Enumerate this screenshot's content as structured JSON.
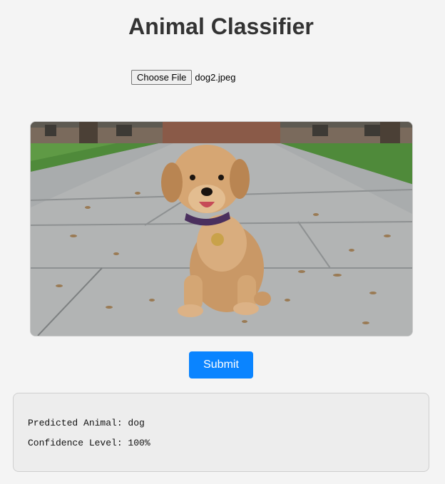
{
  "header": {
    "title": "Animal Classifier"
  },
  "file_input": {
    "button_label": "Choose File",
    "file_name": "dog2.jpeg"
  },
  "preview": {
    "image_description_icon": "dog-photo"
  },
  "actions": {
    "submit_label": "Submit"
  },
  "result": {
    "predicted_line": "Predicted Animal: dog",
    "confidence_line": "Confidence Level: 100%"
  },
  "colors": {
    "accent": "#0a84ff",
    "title": "#333333",
    "background": "#f4f4f4"
  }
}
